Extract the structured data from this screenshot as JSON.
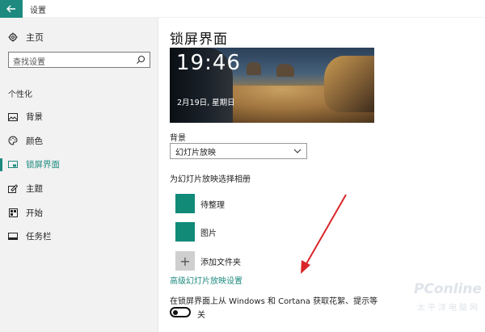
{
  "window": {
    "title": "设置",
    "back_icon": "back-arrow-icon"
  },
  "sidebar": {
    "home_label": "主页",
    "search_placeholder": "查找设置",
    "section_label": "个性化",
    "items": [
      {
        "label": "背景",
        "icon": "picture-icon",
        "active": false
      },
      {
        "label": "颜色",
        "icon": "palette-icon",
        "active": false
      },
      {
        "label": "锁屏界面",
        "icon": "lockscreen-icon",
        "active": true
      },
      {
        "label": "主题",
        "icon": "theme-icon",
        "active": false
      },
      {
        "label": "开始",
        "icon": "start-icon",
        "active": false
      },
      {
        "label": "任务栏",
        "icon": "taskbar-icon",
        "active": false
      }
    ]
  },
  "main": {
    "title": "锁屏界面",
    "preview": {
      "time": "19:46",
      "date": "2月19日, 星期日"
    },
    "background_label": "背景",
    "background_value": "幻灯片放映",
    "album_label": "为幻灯片放映选择相册",
    "albums": [
      {
        "label": "待整理"
      },
      {
        "label": "图片"
      }
    ],
    "add_folder_label": "添加文件夹",
    "advanced_link": "高级幻灯片放映设置",
    "tips_label": "在锁屏界面上从 Windows 和 Cortana 获取花絮、提示等",
    "tips_toggle_state": "关"
  },
  "watermark": {
    "brand": "PConline",
    "cn": "太平洋电脑网"
  },
  "colors": {
    "accent": "#1e8a7f",
    "album_tile": "#118a78",
    "arrow": "#d9262a"
  }
}
